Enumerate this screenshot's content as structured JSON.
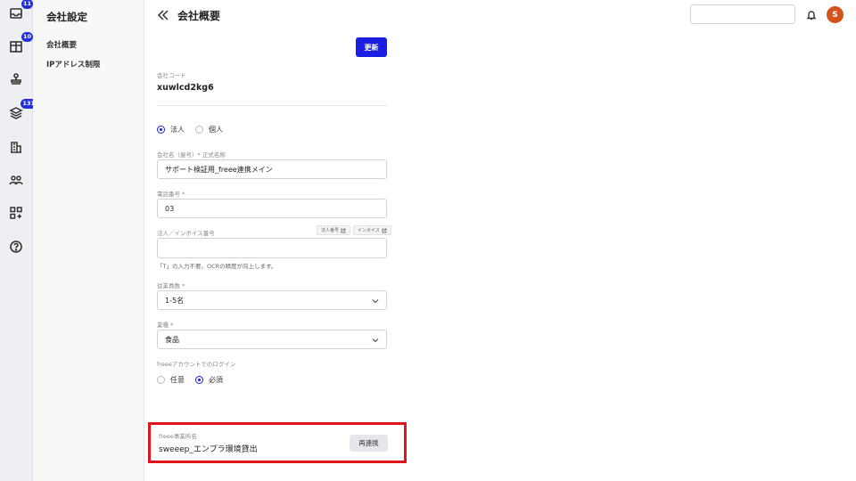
{
  "rail": {
    "items": [
      {
        "icon": "inbox-icon",
        "badge": "11"
      },
      {
        "icon": "columns-icon",
        "badge": "10"
      },
      {
        "icon": "stamp-icon",
        "badge": ""
      },
      {
        "icon": "layers-icon",
        "badge": "131"
      },
      {
        "icon": "building-icon",
        "badge": ""
      },
      {
        "icon": "users-icon",
        "badge": ""
      },
      {
        "icon": "apps-add-icon",
        "badge": ""
      },
      {
        "icon": "help-icon",
        "badge": ""
      }
    ]
  },
  "subnav": {
    "title": "会社設定",
    "items": [
      {
        "label": "会社概要"
      },
      {
        "label": "IPアドレス制限"
      }
    ]
  },
  "header": {
    "title": "会社概要",
    "search_placeholder": "",
    "avatar_initial": "S"
  },
  "form": {
    "update_label": "更新",
    "company_code_label": "会社コード",
    "company_code": "xuwlcd2kg6",
    "entity_type": {
      "options": [
        "法人",
        "個人"
      ],
      "selected": "法人"
    },
    "company_name_label": "会社名（屋号）* 正式名称",
    "company_name": "サポート検証用_freee連携メイン",
    "phone_label": "電話番号 *",
    "phone": "03",
    "invoice_label": "法人／インボイス番号",
    "invoice_value": "",
    "corp_number_link": "法人番号",
    "invoice_link": "インボイス",
    "invoice_hint": "「T」の入力不要。OCRの精度が向上します。",
    "employees_label": "従業員数 *",
    "employees": "1-5名",
    "industry_label": "業種 *",
    "industry": "食品",
    "freee_login_label": "freeeアカウントでのログイン",
    "freee_login": {
      "options": [
        "任意",
        "必須"
      ],
      "selected": "必須"
    }
  },
  "freee": {
    "office_label": "freee事業所名",
    "office_name": "sweeep_エンプラ環境貸出",
    "relink_label": "再連携"
  },
  "colors": {
    "accent": "#1a1ee0",
    "highlight": "#e0141b",
    "avatar": "#d4531d"
  }
}
